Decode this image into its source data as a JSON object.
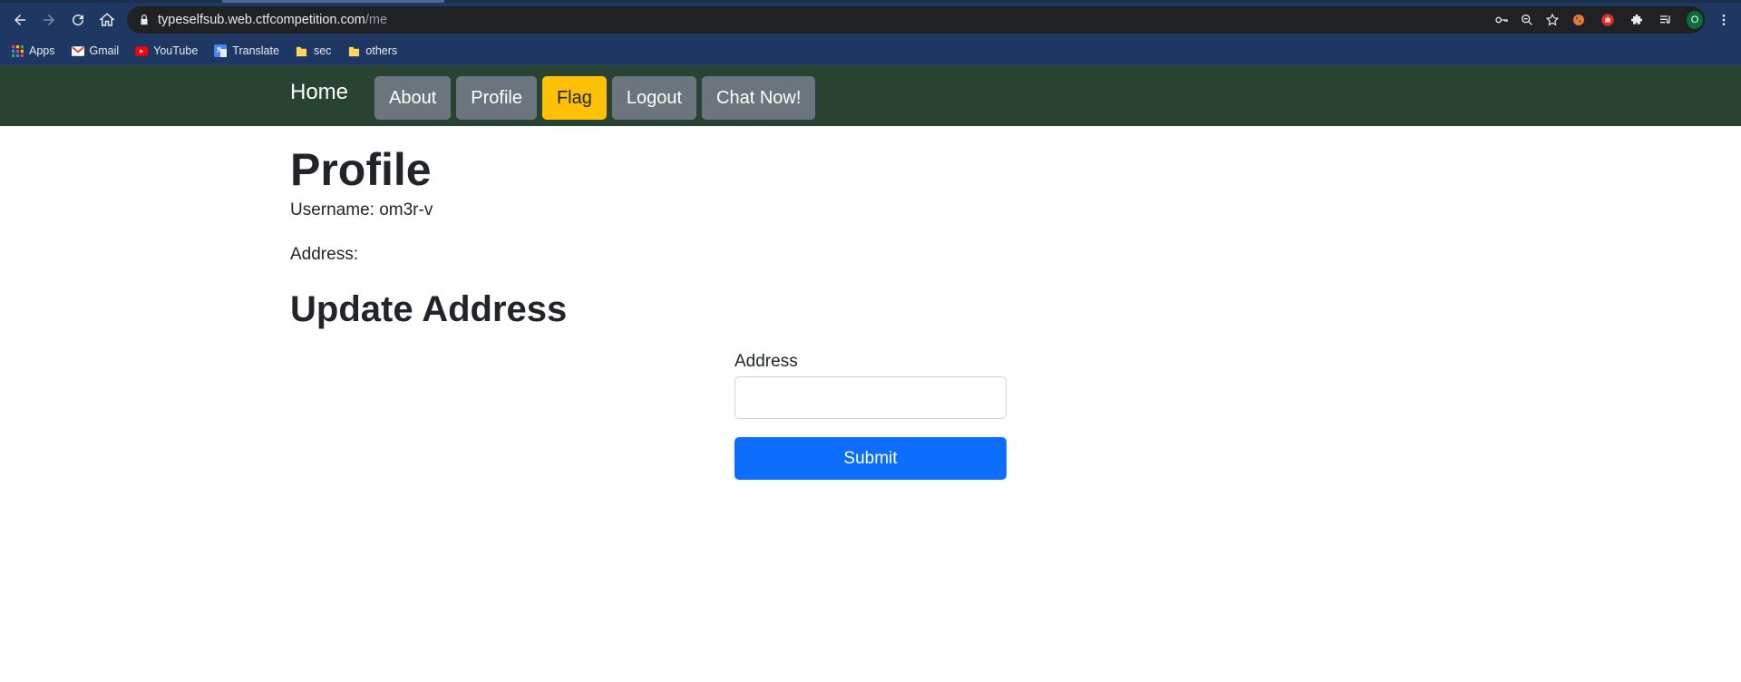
{
  "browser": {
    "url_host": "typeselfsub.web.ctfcompetition.com",
    "url_path": "/me",
    "profile_initial": "O",
    "bookmarks": [
      {
        "label": "Apps",
        "icon": "apps-grid-icon"
      },
      {
        "label": "Gmail",
        "icon": "gmail-icon"
      },
      {
        "label": "YouTube",
        "icon": "youtube-icon"
      },
      {
        "label": "Translate",
        "icon": "translate-icon"
      },
      {
        "label": "sec",
        "icon": "folder-icon"
      },
      {
        "label": "others",
        "icon": "folder-icon"
      }
    ]
  },
  "nav": {
    "brand": "Home",
    "buttons": [
      "About",
      "Profile",
      "Flag",
      "Logout",
      "Chat Now!"
    ]
  },
  "profile": {
    "title": "Profile",
    "username_line": "Username: om3r-v",
    "address_line": "Address:"
  },
  "update": {
    "title": "Update Address",
    "field_label": "Address",
    "field_value": "",
    "submit_label": "Submit"
  },
  "colors": {
    "navbar_bg": "#284331",
    "button_secondary": "#6c757d",
    "button_warning": "#ffc107",
    "button_primary": "#0d6efd"
  }
}
